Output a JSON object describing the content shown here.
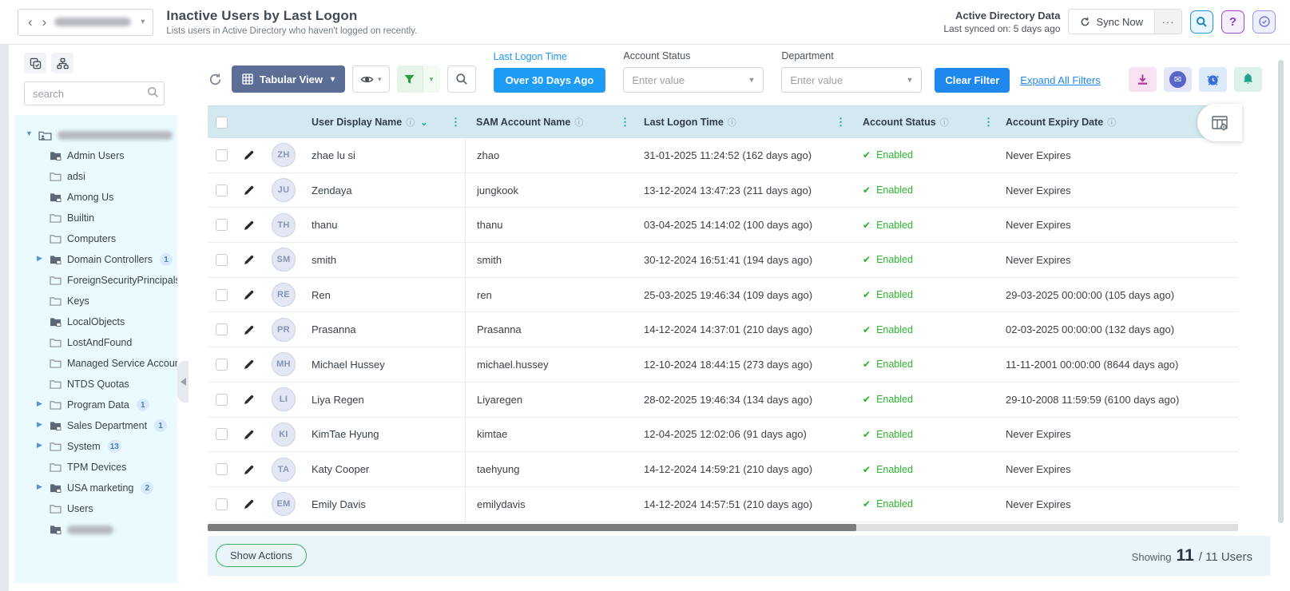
{
  "header": {
    "title": "Inactive Users by Last Logon",
    "subtitle": "Lists users in Active Directory who haven't logged on recently.",
    "domain_selector": {
      "redacted": true
    },
    "sync_title": "Active Directory Data",
    "last_synced": "Last synced on: 5 days ago",
    "sync_button": "Sync Now"
  },
  "icons": {
    "back": "‹",
    "forward": "›",
    "nav_caret": "▾",
    "more": "···",
    "help": "?",
    "select_caret": "▼",
    "view_caret": "▾",
    "eye_caret": "▾",
    "filter_caret": "▾",
    "sort": "⌄",
    "col_menu": "⋮",
    "info": "ⓘ",
    "check": "✔",
    "tree_expanded": "▼",
    "tree_collapsed": "▶",
    "envelope": "✉"
  },
  "sidebar": {
    "search_placeholder": "search",
    "tree": [
      {
        "label": "",
        "redacted": true,
        "root": true,
        "expanded": true,
        "icon_root": true
      },
      {
        "label": "Admin Users",
        "lvl1": true,
        "icon_ou": true
      },
      {
        "label": "adsi",
        "lvl1": true,
        "icon_folder": true
      },
      {
        "label": "Among Us",
        "lvl1": true,
        "icon_ou": true
      },
      {
        "label": "Builtin",
        "lvl1": true,
        "icon_folder": true
      },
      {
        "label": "Computers",
        "lvl1": true,
        "icon_folder": true
      },
      {
        "label": "Domain Controllers",
        "lvl1": true,
        "icon_ou": true,
        "collapsed": true,
        "badge": "1"
      },
      {
        "label": "ForeignSecurityPrincipals",
        "lvl1": true,
        "icon_folder": true
      },
      {
        "label": "Keys",
        "lvl1": true,
        "icon_folder": true
      },
      {
        "label": "LocalObjects",
        "lvl1": true,
        "icon_ou": true
      },
      {
        "label": "LostAndFound",
        "lvl1": true,
        "icon_folder": true
      },
      {
        "label": "Managed Service Accounts",
        "lvl1": true,
        "icon_folder": true
      },
      {
        "label": "NTDS Quotas",
        "lvl1": true,
        "icon_folder": true
      },
      {
        "label": "Program Data",
        "lvl1": true,
        "icon_folder": true,
        "collapsed": true,
        "badge": "1"
      },
      {
        "label": "Sales Department",
        "lvl1": true,
        "icon_ou": true,
        "collapsed": true,
        "badge": "1"
      },
      {
        "label": "System",
        "lvl1": true,
        "icon_folder": true,
        "collapsed": true,
        "badge": "13"
      },
      {
        "label": "TPM Devices",
        "lvl1": true,
        "icon_folder": true
      },
      {
        "label": "USA marketing",
        "lvl1": true,
        "icon_ou": true,
        "collapsed": true,
        "badge": "2"
      },
      {
        "label": "Users",
        "lvl1": true,
        "icon_folder": true
      },
      {
        "label": "",
        "redacted": true,
        "lvl1": true,
        "icon_ou": true
      }
    ]
  },
  "toolbar": {
    "view_button": "Tabular View",
    "last_logon_label": "Last Logon Time",
    "last_logon_value": "Over 30 Days Ago",
    "account_status_label": "Account Status",
    "account_status_placeholder": "Enter value",
    "department_label": "Department",
    "department_placeholder": "Enter value",
    "clear_filter": "Clear Filter",
    "expand_all": "Expand All Filters"
  },
  "table": {
    "columns": [
      "User Display Name",
      "SAM Account Name",
      "Last Logon Time",
      "Account Status",
      "Account Expiry Date"
    ],
    "rows": [
      {
        "initials": "ZH",
        "display_name": "zhae lu si",
        "sam": "zhao",
        "last_logon": "31-01-2025 11:24:52 (162 days ago)",
        "status": "Enabled",
        "expiry": "Never Expires"
      },
      {
        "initials": "JU",
        "display_name": "Zendaya",
        "sam": "jungkook",
        "last_logon": "13-12-2024 13:47:23 (211 days ago)",
        "status": "Enabled",
        "expiry": "Never Expires"
      },
      {
        "initials": "TH",
        "display_name": "thanu",
        "sam": "thanu",
        "last_logon": "03-04-2025 14:14:02 (100 days ago)",
        "status": "Enabled",
        "expiry": "Never Expires"
      },
      {
        "initials": "SM",
        "display_name": "smith",
        "sam": "smith",
        "last_logon": "30-12-2024 16:51:41 (194 days ago)",
        "status": "Enabled",
        "expiry": "Never Expires"
      },
      {
        "initials": "RE",
        "display_name": "Ren",
        "sam": "ren",
        "last_logon": "25-03-2025 19:46:34 (109 days ago)",
        "status": "Enabled",
        "expiry": "29-03-2025 00:00:00 (105 days ago)"
      },
      {
        "initials": "PR",
        "display_name": "Prasanna",
        "sam": "Prasanna",
        "last_logon": "14-12-2024 14:37:01 (210 days ago)",
        "status": "Enabled",
        "expiry": "02-03-2025 00:00:00 (132 days ago)"
      },
      {
        "initials": "MH",
        "display_name": "Michael Hussey",
        "sam": "michael.hussey",
        "last_logon": "12-10-2024 18:44:15 (273 days ago)",
        "status": "Enabled",
        "expiry": "11-11-2001 00:00:00 (8644 days ago)"
      },
      {
        "initials": "LI",
        "display_name": "Liya Regen",
        "sam": "Liyaregen",
        "last_logon": "28-02-2025 19:46:34 (134 days ago)",
        "status": "Enabled",
        "expiry": "29-10-2008 11:59:59 (6100 days ago)"
      },
      {
        "initials": "KI",
        "display_name": "KimTae Hyung",
        "sam": "kimtae",
        "last_logon": "12-04-2025 12:02:06 (91 days ago)",
        "status": "Enabled",
        "expiry": "Never Expires"
      },
      {
        "initials": "TA",
        "display_name": "Katy Cooper",
        "sam": "taehyung",
        "last_logon": "14-12-2024 14:59:21 (210 days ago)",
        "status": "Enabled",
        "expiry": "Never Expires"
      },
      {
        "initials": "EM",
        "display_name": "Emily Davis",
        "sam": "emilydavis",
        "last_logon": "14-12-2024 14:57:51 (210 days ago)",
        "status": "Enabled",
        "expiry": "Never Expires"
      }
    ]
  },
  "footer": {
    "show_actions": "Show Actions",
    "showing_label": "Showing",
    "shown_count": "11",
    "total_suffix": "/ 11 Users"
  },
  "colors": {
    "accent_blue": "#1e9cf5",
    "view_button": "#5c6e96",
    "table_header_bg": "#d3e9ef",
    "status_green": "#2db52d",
    "teal_dots": "#12a3a8",
    "tree_bg": "#e9fbff",
    "footer_bg": "#e9f5fa"
  }
}
